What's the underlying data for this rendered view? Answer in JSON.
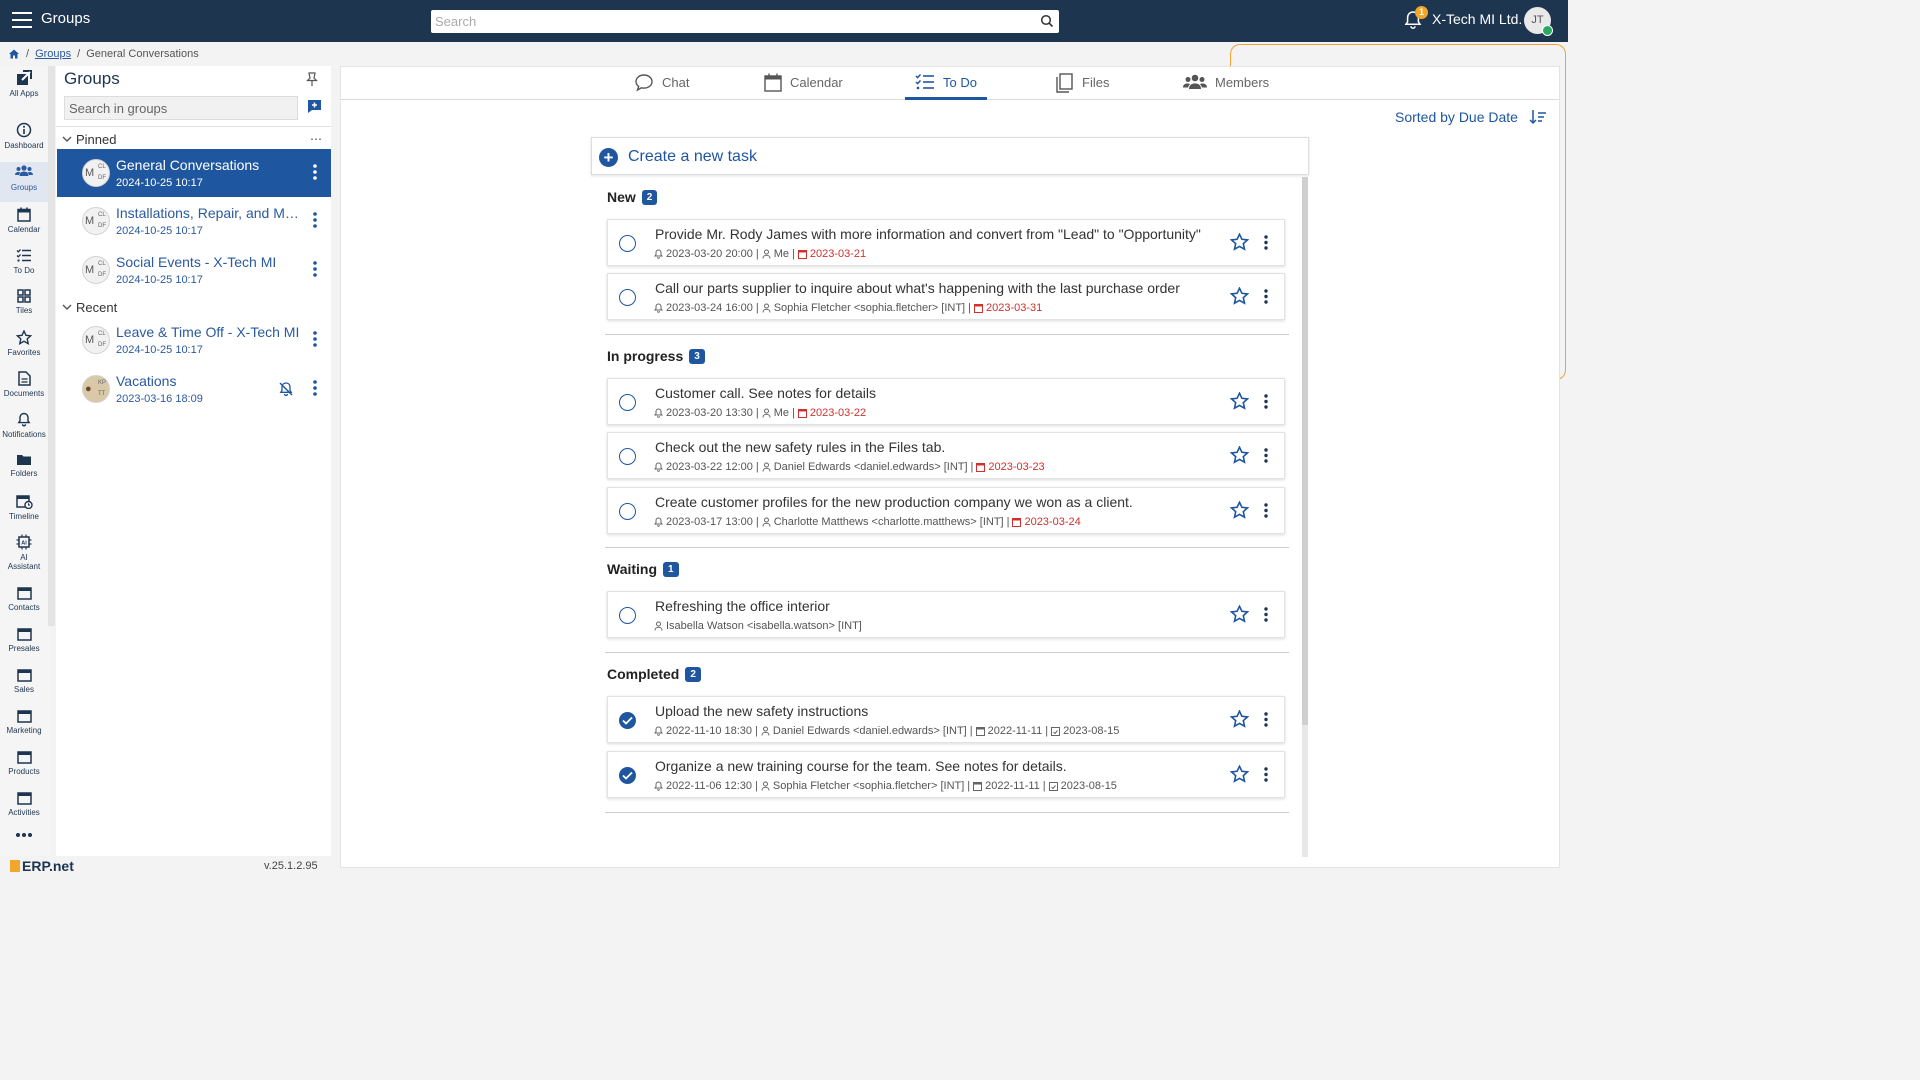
{
  "topbar": {
    "title": "Groups",
    "search_placeholder": "Search",
    "notification_count": "1",
    "company": "X-Tech MI Ltd.",
    "user_initials": "JT"
  },
  "breadcrumb": {
    "items": [
      "Groups",
      "General Conversations"
    ]
  },
  "rail": {
    "items": [
      {
        "label": "All Apps",
        "icon": "all-apps-icon"
      },
      {
        "label": "Dashboard",
        "icon": "info-icon"
      },
      {
        "label": "Groups",
        "icon": "groups-icon"
      },
      {
        "label": "Calendar",
        "icon": "calendar-icon"
      },
      {
        "label": "To Do",
        "icon": "todo-icon"
      },
      {
        "label": "Tiles",
        "icon": "tiles-icon"
      },
      {
        "label": "Favorites",
        "icon": "star-icon"
      },
      {
        "label": "Documents",
        "icon": "document-icon"
      },
      {
        "label": "Notifications",
        "icon": "bell-icon"
      },
      {
        "label": "Folders",
        "icon": "folder-icon"
      },
      {
        "label": "Timeline",
        "icon": "timeline-icon"
      },
      {
        "label": "AI Assistant",
        "icon": "ai-icon"
      },
      {
        "label": "Contacts",
        "icon": "window-icon"
      },
      {
        "label": "Presales",
        "icon": "window-icon"
      },
      {
        "label": "Sales",
        "icon": "window-icon"
      },
      {
        "label": "Marketing",
        "icon": "window-icon"
      },
      {
        "label": "Products",
        "icon": "window-icon"
      },
      {
        "label": "Activities",
        "icon": "window-icon"
      }
    ]
  },
  "groups": {
    "title": "Groups",
    "search_placeholder": "Search in groups",
    "pinned_label": "Pinned",
    "recent_label": "Recent",
    "pinned": [
      {
        "name": "General Conversations",
        "date": "2024-10-25 10:17"
      },
      {
        "name": "Installations, Repair, and Maintenance",
        "date": "2024-10-25 10:17"
      },
      {
        "name": "Social Events - X-Tech MI",
        "date": "2024-10-25 10:17"
      }
    ],
    "recent": [
      {
        "name": "Leave & Time Off - X-Tech MI",
        "date": "2024-10-25 10:17"
      },
      {
        "name": "Vacations",
        "date": "2023-03-16 18:09"
      }
    ],
    "logo": "ERP.net",
    "version": "v.25.1.2.95"
  },
  "tabs": [
    "Chat",
    "Calendar",
    "To Do",
    "Files",
    "Members"
  ],
  "active_tab": "To Do",
  "sort_label": "Sorted by Due Date",
  "create_task_label": "Create a new task",
  "sections": [
    {
      "name": "New",
      "count": "2",
      "tasks": [
        {
          "title": "Provide Mr. Rody James with more information and convert from \"Lead\" to \"Opportunity\"",
          "reminder": "2023-03-20 20:00",
          "assignee": "Me",
          "due": "2023-03-21"
        },
        {
          "title": "Call our parts supplier to inquire about what's happening with the last purchase order",
          "reminder": "2023-03-24 16:00",
          "assignee": "Sophia Fletcher <sophia.fletcher> [INT]",
          "due": "2023-03-31"
        }
      ]
    },
    {
      "name": "In progress",
      "count": "3",
      "tasks": [
        {
          "title": "Customer call. See notes for details",
          "reminder": "2023-03-20 13:30",
          "assignee": "Me",
          "due": "2023-03-22"
        },
        {
          "title": "Check out the new safety rules in the Files tab.",
          "reminder": "2023-03-22 12:00",
          "assignee": "Daniel Edwards <daniel.edwards> [INT]",
          "due": "2023-03-23"
        },
        {
          "title": "Create customer profiles for the new production company we won as a client.",
          "reminder": "2023-03-17 13:00",
          "assignee": "Charlotte Matthews <charlotte.matthews> [INT]",
          "due": "2023-03-24"
        }
      ]
    },
    {
      "name": "Waiting",
      "count": "1",
      "tasks": [
        {
          "title": "Refreshing the office interior",
          "assignee": "Isabella Watson <isabella.watson> [INT]"
        }
      ]
    },
    {
      "name": "Completed",
      "count": "2",
      "tasks": [
        {
          "title": "Upload the new safety instructions",
          "reminder": "2022-11-10 18:30",
          "assignee": "Daniel Edwards <daniel.edwards> [INT]",
          "due": "2022-11-11",
          "completed": "2023-08-15"
        },
        {
          "title": "Organize a new training course for the team. See notes for details.",
          "reminder": "2022-11-06 12:30",
          "assignee": "Sophia Fletcher <sophia.fletcher> [INT]",
          "due": "2022-11-11",
          "completed": "2023-08-15"
        }
      ]
    }
  ],
  "colors": {
    "topbar": "#1e3550",
    "accent": "#1f56a0",
    "overdue": "#d0312d",
    "badge": "#f0a72b"
  }
}
